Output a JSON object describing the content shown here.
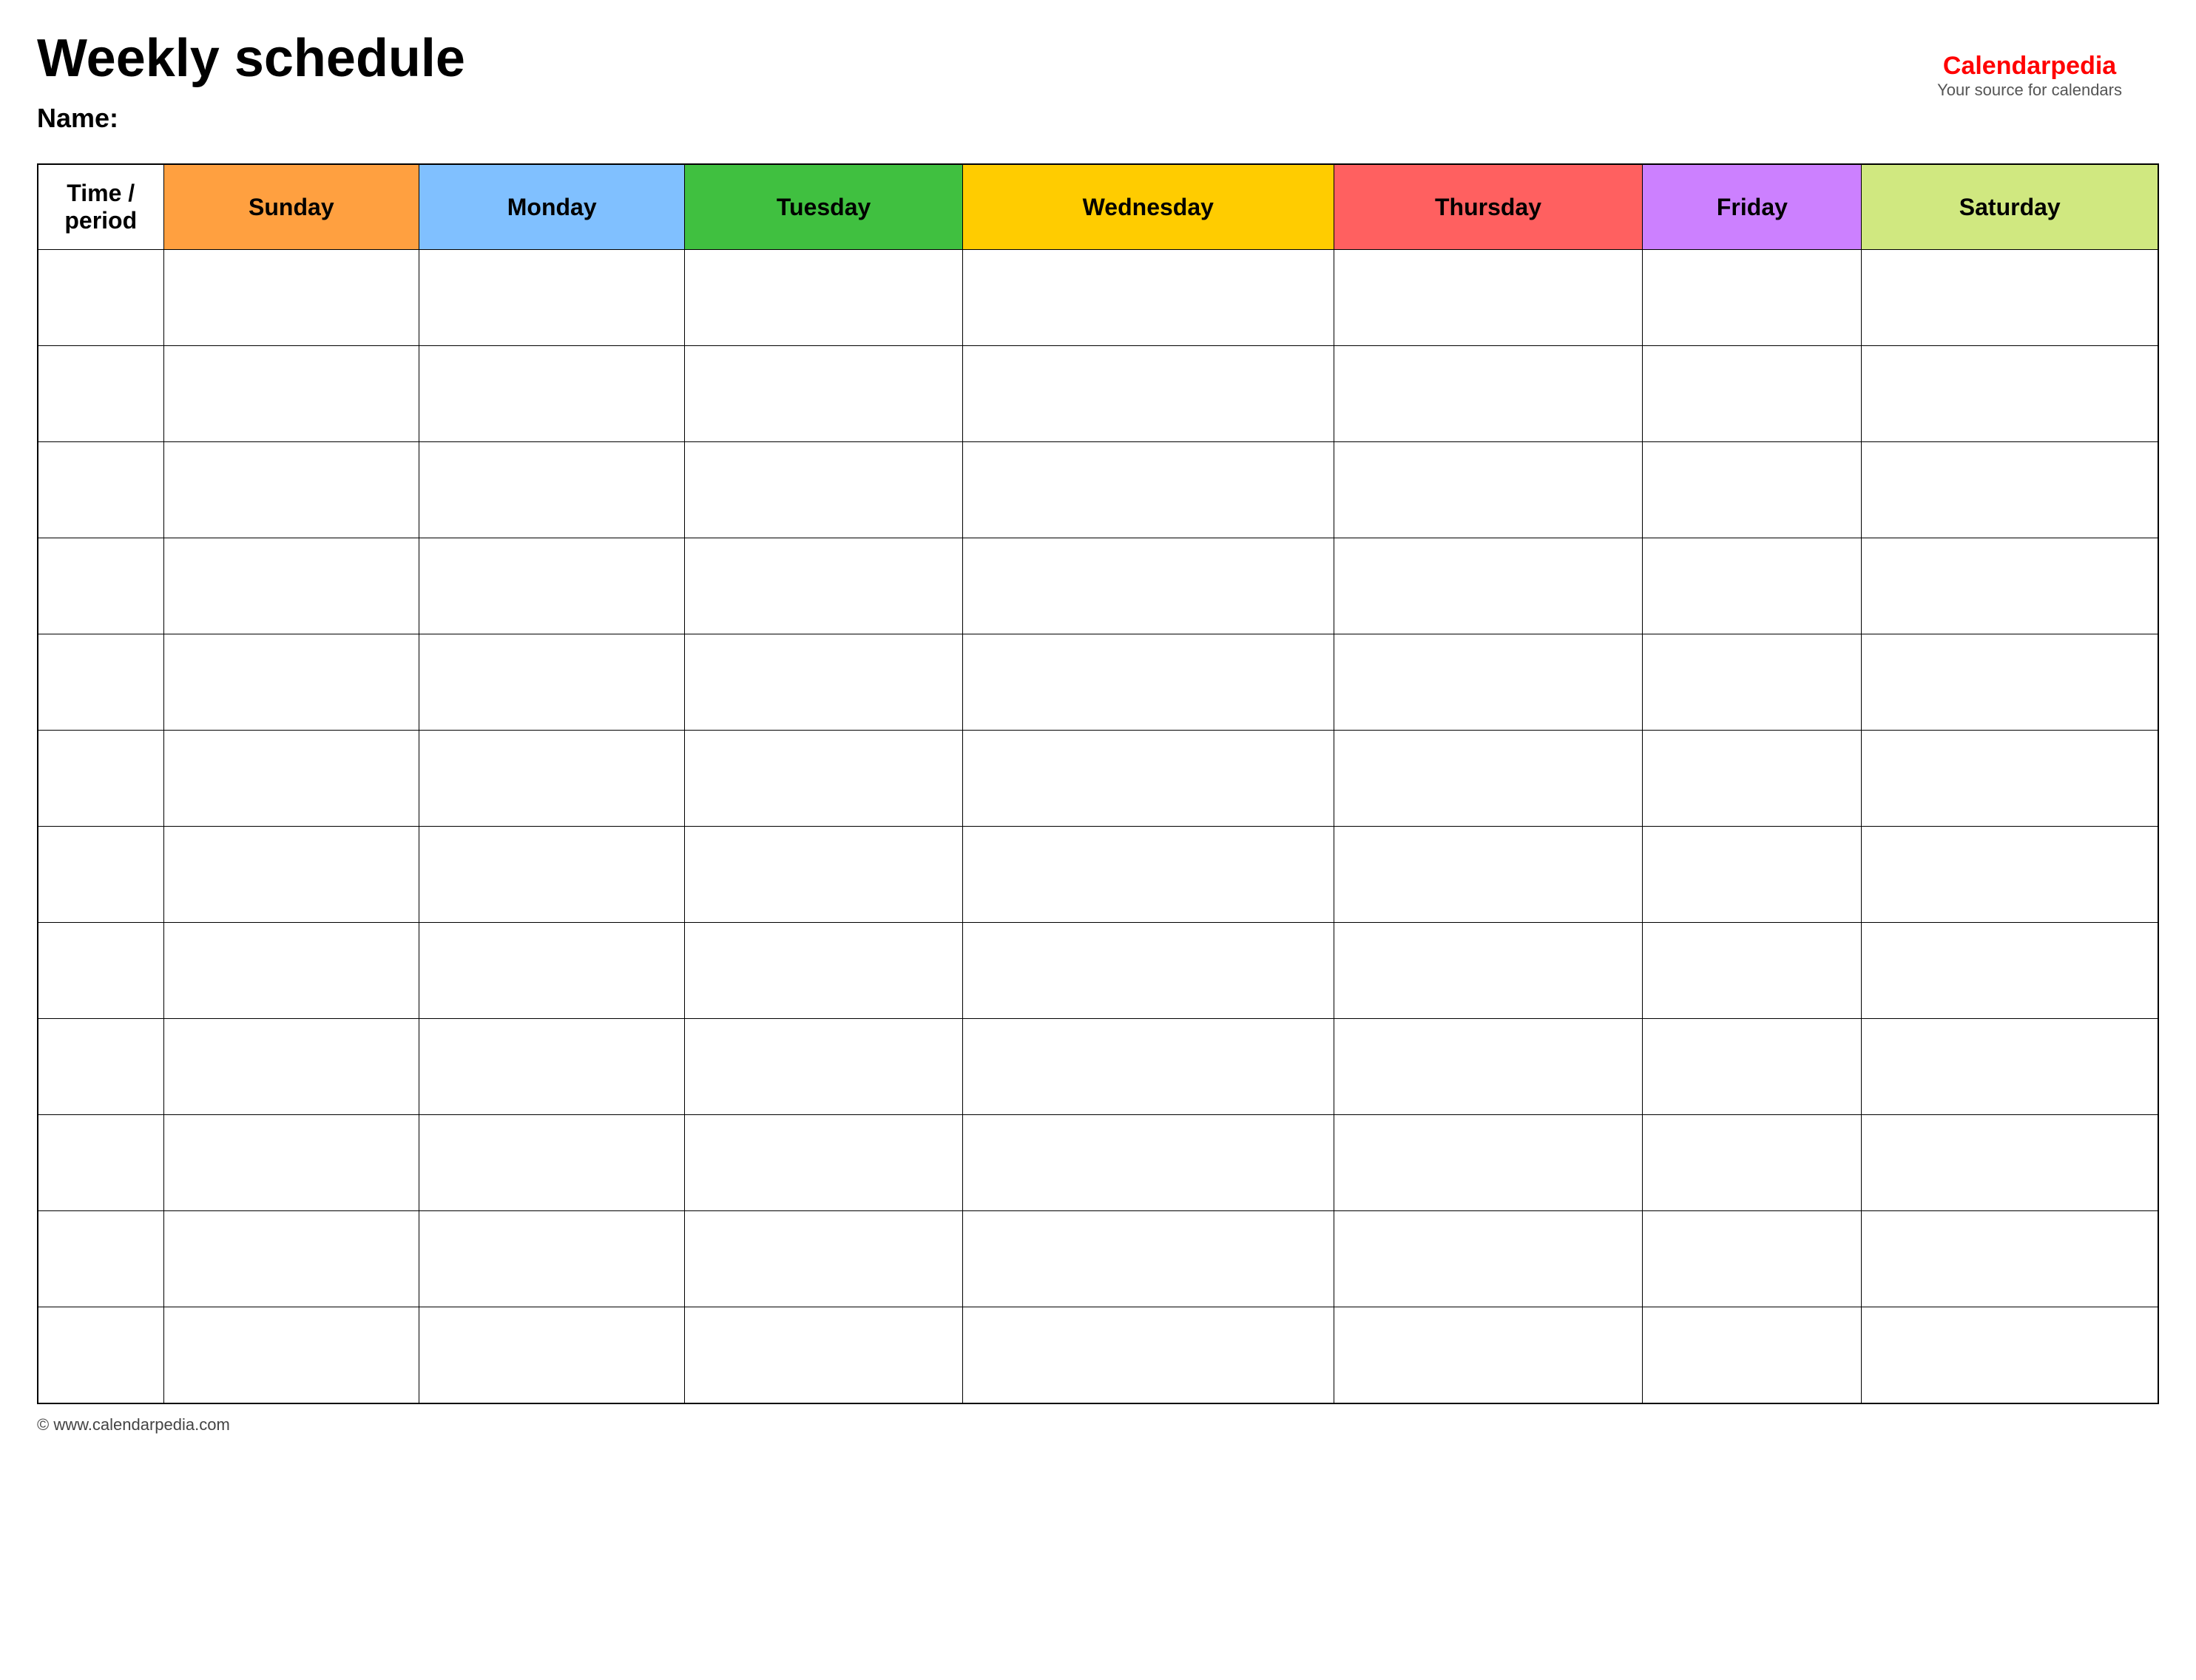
{
  "page": {
    "title": "Weekly schedule",
    "name_label": "Name:",
    "footer_text": "© www.calendarpedia.com"
  },
  "logo": {
    "brand_part1": "Calendar",
    "brand_part2": "pedia",
    "tagline": "Your source for calendars"
  },
  "table": {
    "header": {
      "time_period": "Time / period",
      "days": [
        "Sunday",
        "Monday",
        "Tuesday",
        "Wednesday",
        "Thursday",
        "Friday",
        "Saturday"
      ]
    },
    "rows": 12
  }
}
